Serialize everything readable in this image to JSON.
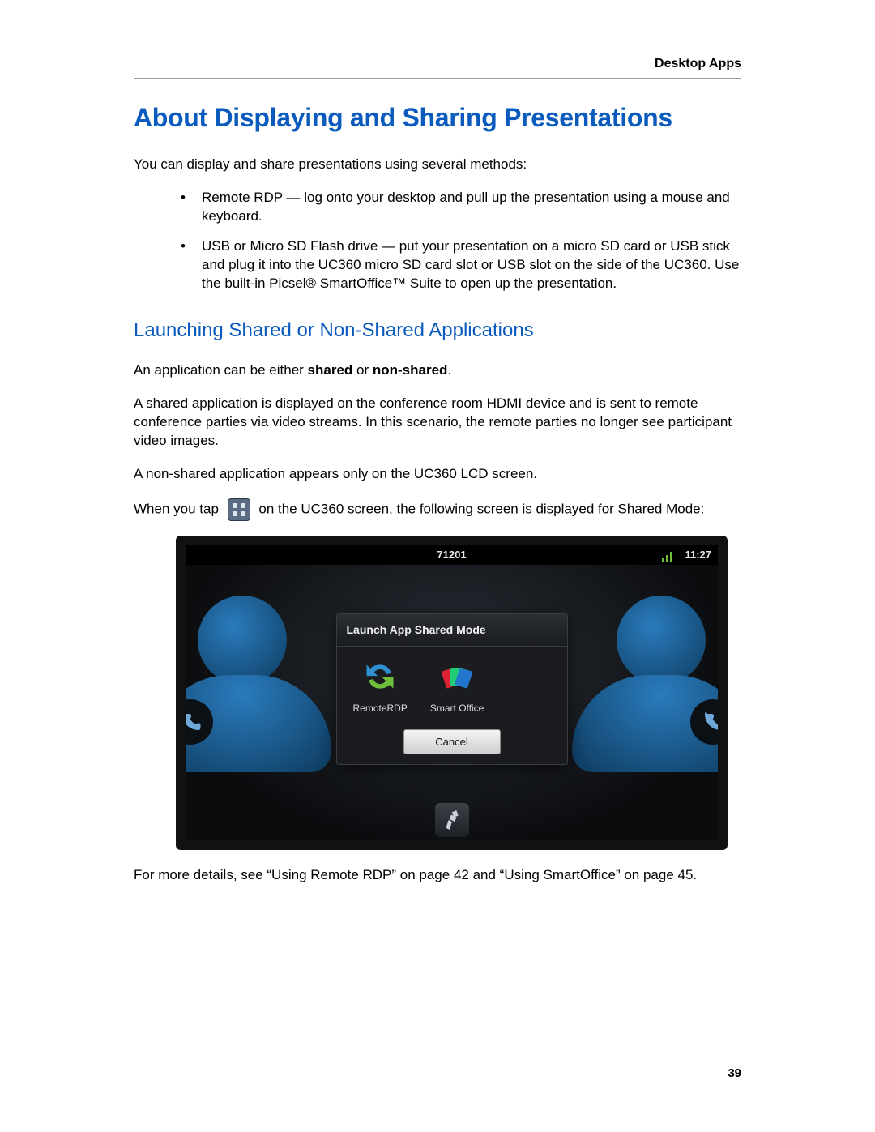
{
  "header": {
    "section": "Desktop Apps"
  },
  "title": "About Displaying and Sharing Presentations",
  "intro": "You can display and share presentations using several methods:",
  "bullets": [
    "Remote RDP — log onto your desktop and pull up the presentation using a mouse and keyboard.",
    "USB or Micro SD Flash drive — put your presentation on a micro SD card or USB stick and plug it into the UC360 micro SD card slot or USB slot on the side of the UC360. Use the built-in Picsel® SmartOffice™ Suite to open up the presentation."
  ],
  "subheading": "Launching Shared or Non-Shared Applications",
  "para1_a": "An application can be either ",
  "para1_b": "shared",
  "para1_c": " or ",
  "para1_d": "non-shared",
  "para1_e": ".",
  "para2": "A shared application is displayed on the conference room HDMI device and is sent to remote conference parties via video streams. In this scenario, the remote parties no longer see participant video images.",
  "para3": "A non-shared application appears only on the UC360 LCD screen.",
  "para4_a": "When you tap",
  "para4_b": "on the UC360 screen, the following screen is displayed for Shared Mode:",
  "footer_para": "For more details, see “Using Remote RDP” on page 42 and “Using SmartOffice” on page 45.",
  "page_number": "39",
  "device": {
    "extension": "71201",
    "time": "11:27",
    "dialog_title": "Launch App Shared Mode",
    "app1": "RemoteRDP",
    "app2": "Smart Office",
    "cancel": "Cancel"
  }
}
